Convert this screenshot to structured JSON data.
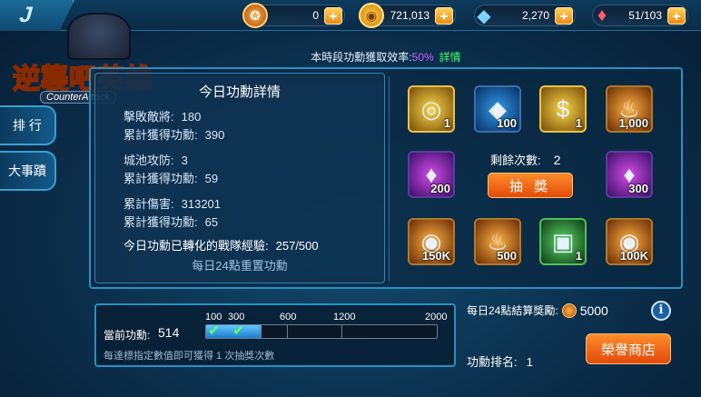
{
  "topbar": {
    "back_glyph": "J",
    "resources": [
      {
        "icon": "medal-icon",
        "glyph": "✪",
        "value": "0"
      },
      {
        "icon": "coin-icon",
        "glyph": "◉",
        "value": "721,013"
      },
      {
        "icon": "crystal-icon",
        "glyph": "◆",
        "value": "2,270"
      },
      {
        "icon": "ruby-icon",
        "glyph": "♦",
        "value": "51/103"
      }
    ],
    "plus": "+"
  },
  "logo": {
    "title": "逆襲吧英雄",
    "subtitle": "CounterAttack"
  },
  "side_tabs": [
    "排 行",
    "大事蹟"
  ],
  "efficiency": {
    "label": "本時段功勳獲取效率:",
    "percent": "50%",
    "detail": "詳情"
  },
  "today": {
    "title": "今日功勳詳情",
    "stats": [
      {
        "label": "擊敗敵將:",
        "value": "180"
      },
      {
        "label": "累計獲得功勳:",
        "value": "390"
      },
      {
        "label": "城池攻防:",
        "value": "3"
      },
      {
        "label": "累計獲得功勳:",
        "value": "59"
      },
      {
        "label": "累計傷害:",
        "value": "313201"
      },
      {
        "label": "累計獲得功勳:",
        "value": "65"
      }
    ],
    "converted_label": "今日功勳已轉化的戰隊經驗:",
    "converted_value": "257/500",
    "reset_note": "每日24點重置功勳"
  },
  "rewards": {
    "slots": [
      {
        "icon": "gold-ring-icon",
        "glyph": "◎",
        "count": "1",
        "style": "s-gold"
      },
      {
        "icon": "blue-crystal-icon",
        "glyph": "◆",
        "count": "100",
        "style": "s-blue"
      },
      {
        "icon": "gold-emblem-icon",
        "glyph": "$",
        "count": "1",
        "style": "s-gold"
      },
      {
        "icon": "orange-flame-icon",
        "glyph": "♨",
        "count": "1,000",
        "style": "s-orange"
      },
      {
        "icon": "purple-gem-icon",
        "glyph": "♦",
        "count": "200",
        "style": "s-purple"
      },
      {
        "icon": "purple-gem-icon",
        "glyph": "♦",
        "count": "300",
        "style": "s-purple"
      },
      {
        "icon": "gold-coin-icon",
        "glyph": "◉",
        "count": "150K",
        "style": "s-orange"
      },
      {
        "icon": "orange-flame-icon",
        "glyph": "♨",
        "count": "500",
        "style": "s-orange"
      },
      {
        "icon": "green-chest-icon",
        "glyph": "▣",
        "count": "1",
        "style": "s-green"
      },
      {
        "icon": "gold-coin-icon",
        "glyph": "◉",
        "count": "100K",
        "style": "s-orange"
      }
    ],
    "remaining_label": "剩餘次數:",
    "remaining_value": "2",
    "draw_label": "抽 獎"
  },
  "progress": {
    "current_label": "當前功勳:",
    "current_value": "514",
    "ticks": [
      "100",
      "300",
      "600",
      "1200",
      "2000"
    ],
    "fill_fraction": 0.24,
    "checks": "✔",
    "hint": "每達標指定數值即可獲得 1 次抽獎次數"
  },
  "settlement": {
    "label": "每日24點結算獎勵:",
    "value": "5000"
  },
  "info_glyph": "i",
  "rank": {
    "label": "功勳排名:",
    "value": "1"
  },
  "shop_label": "榮譽商店"
}
